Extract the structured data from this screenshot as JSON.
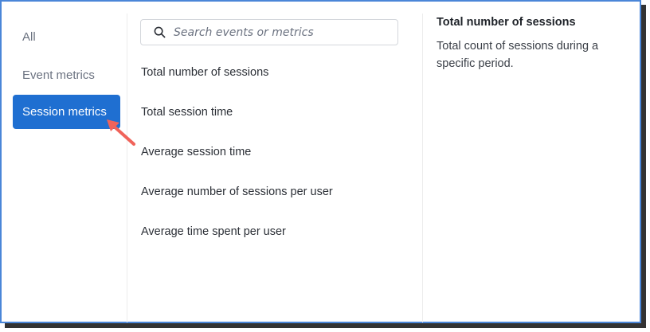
{
  "nav": {
    "items": [
      {
        "label": "All",
        "active": false
      },
      {
        "label": "Event metrics",
        "active": false
      },
      {
        "label": "Session metrics",
        "active": true
      }
    ]
  },
  "search": {
    "placeholder": "Search events or metrics",
    "icon": "search-icon"
  },
  "metrics": {
    "items": [
      {
        "label": "Total number of sessions"
      },
      {
        "label": "Total session time"
      },
      {
        "label": "Average session time"
      },
      {
        "label": "Average number of sessions per user"
      },
      {
        "label": "Average time spent per user"
      }
    ]
  },
  "detail": {
    "title": "Total number of sessions",
    "description": "Total count of sessions during a specific period."
  },
  "colors": {
    "accent": "#1f6fd1",
    "frame_border": "#4a86d8",
    "annotation_arrow": "#f0635a"
  }
}
